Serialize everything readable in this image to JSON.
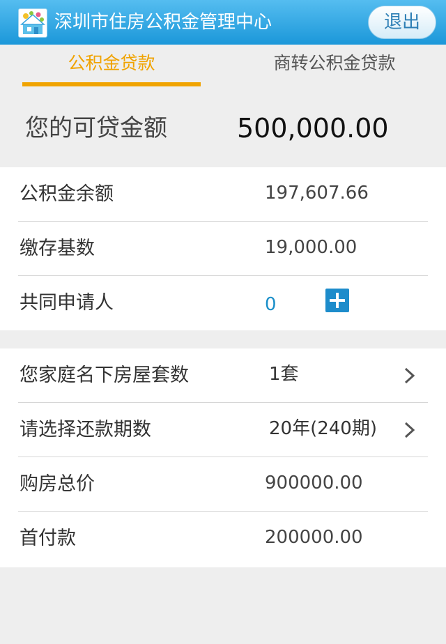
{
  "header": {
    "title": "深圳市住房公积金管理中心",
    "logout_label": "退出"
  },
  "tabs": [
    {
      "label": "公积金贷款",
      "active": true
    },
    {
      "label": "商转公积金贷款",
      "active": false
    }
  ],
  "loanable": {
    "label": "您的可贷金额",
    "value": "500,000.00"
  },
  "account_rows": [
    {
      "label": "公积金余额",
      "value": "197,607.66"
    },
    {
      "label": "缴存基数",
      "value": "19,000.00"
    },
    {
      "label": "共同申请人",
      "value": "0"
    }
  ],
  "loan_rows": [
    {
      "label": "您家庭名下房屋套数",
      "value": "1套"
    },
    {
      "label": "请选择还款期数",
      "value": "20年(240期)"
    },
    {
      "label": "购房总价",
      "value": "900000.00"
    },
    {
      "label": "首付款",
      "value": "200000.00"
    }
  ],
  "colors": {
    "header": "#1b97d9",
    "active_tab": "#f0a300",
    "plus_button": "#1d8ccb",
    "background": "#eeeeee"
  },
  "icons": {
    "logo": "housing-fund-logo",
    "add": "plus-icon",
    "chevron": "chevron-right-icon"
  }
}
